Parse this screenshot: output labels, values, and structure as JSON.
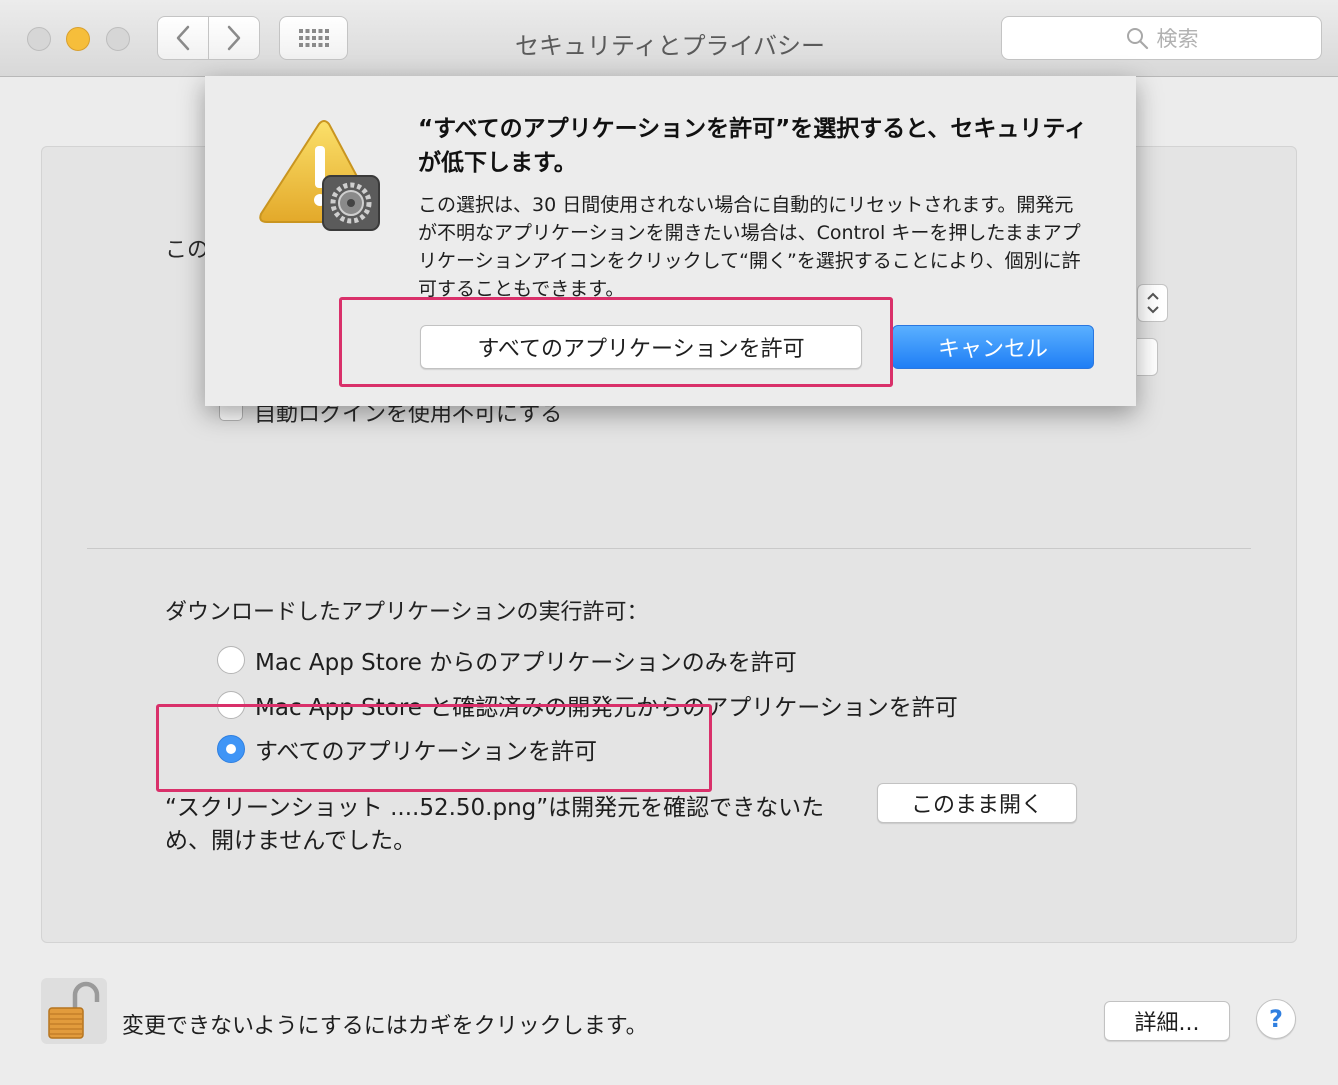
{
  "window": {
    "title": "セキュリティとプライバシー",
    "search_placeholder": "検索"
  },
  "background": {
    "partial_label": "この",
    "partial_checkbox_label": "自動ログインを使用不可にする"
  },
  "gatekeeper": {
    "section_label": "ダウンロードしたアプリケーションの実行許可：",
    "options": [
      {
        "label": "Mac App Store からのアプリケーションのみを許可",
        "selected": false
      },
      {
        "label": "Mac App Store と確認済みの開発元からのアプリケーションを許可",
        "selected": false
      },
      {
        "label": "すべてのアプリケーションを許可",
        "selected": true
      }
    ],
    "blocked_message": "“スクリーンショット ....52.50.png”は開発元を確認できないため、開けませんでした。",
    "open_anyway_label": "このまま開く"
  },
  "footer": {
    "lock_message": "変更できないようにするにはカギをクリックします。",
    "details_label": "詳細...",
    "help_label": "?"
  },
  "alert": {
    "title": "“すべてのアプリケーションを許可”を選択すると、セキュリティが低下します。",
    "body": "この選択は、30 日間使用されない場合に自動的にリセットされます。開発元が不明なアプリケーションを開きたい場合は、Control キーを押したままアプリケーションアイコンをクリックして“開く”を選択することにより、個別に許可することもできます。",
    "allow_button_label": "すべてのアプリケーションを許可",
    "cancel_button_label": "キャンセル"
  },
  "colors": {
    "accent": "#3f95f6",
    "highlight": "#d9306a",
    "warning_icon": "#f2c12e"
  }
}
